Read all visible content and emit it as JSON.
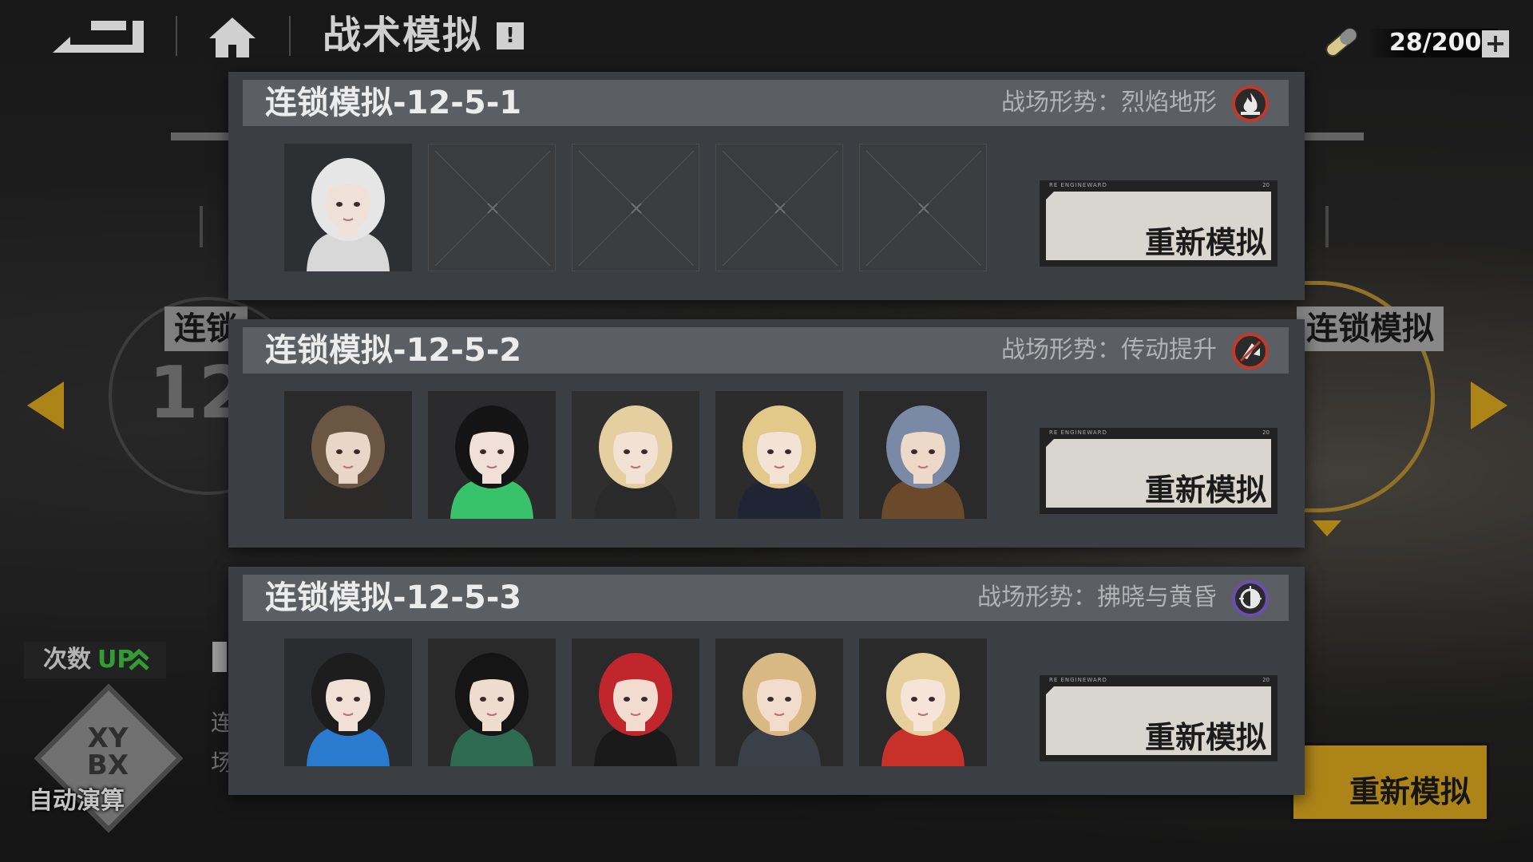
{
  "topbar": {
    "title": "战术模拟",
    "info_label": "!",
    "stamina": "28/200",
    "plus_label": "+"
  },
  "background": {
    "stage_left_label": "连锁",
    "stage_left_num": "12-",
    "stage_right_label": "连锁模拟",
    "count_up_label": "次数",
    "count_up_badge": "UP",
    "desc_line1": "连",
    "desc_line2": "场",
    "auto_logo": "XY\nBX",
    "auto_label": "自动演算",
    "yellow_button_label": "重新模拟"
  },
  "records": [
    {
      "title": "连锁模拟-12-5-1",
      "condition": "战场形势：烈焰地形",
      "condition_icon": "flame-icon",
      "accent": "#c0392b",
      "button_label": "重新模拟",
      "button_tag": "RE  ENGINEWARD",
      "button_num": "20",
      "team": [
        {
          "name": "white-hair-girl",
          "filled": true,
          "hair": "#e6e6e6",
          "skin": "#efe0d8",
          "bg": "#2d2f33",
          "outfit": "#d8d8d8"
        },
        {
          "filled": false
        },
        {
          "filled": false
        },
        {
          "filled": false
        },
        {
          "filled": false
        }
      ]
    },
    {
      "title": "连锁模拟-12-5-2",
      "condition": "战场形势：传动提升",
      "condition_icon": "gear-up-icon",
      "accent": "#c0392b",
      "button_label": "重新模拟",
      "button_tag": "RE  ENGINEWARD",
      "button_num": "20",
      "team": [
        {
          "name": "brown-hair-lady",
          "filled": true,
          "hair": "#6b5644",
          "skin": "#ead6c6",
          "bg": "#2a2a2a",
          "outfit": "#2b2a28"
        },
        {
          "name": "black-hair-catgirl",
          "filled": true,
          "hair": "#141414",
          "skin": "#f0e0d8",
          "bg": "#2b2b2e",
          "outfit": "#38c26a"
        },
        {
          "name": "blonde-wavy-girl",
          "filled": true,
          "hair": "#e3cfa0",
          "skin": "#f2e2d4",
          "bg": "#2f2f30",
          "outfit": "#2a2a2a"
        },
        {
          "name": "officer-cap-girl",
          "filled": true,
          "hair": "#e2c98a",
          "skin": "#f3e2d6",
          "bg": "#2c2c2c",
          "outfit": "#1f2535"
        },
        {
          "name": "cowboy-hat-girl",
          "filled": true,
          "hair": "#7a8aa6",
          "skin": "#eed8c8",
          "bg": "#2a2a2a",
          "outfit": "#6a4a2a"
        }
      ]
    },
    {
      "title": "连锁模拟-12-5-3",
      "condition": "战场形势：拂晓与黄昏",
      "condition_icon": "dawn-dusk-icon",
      "accent": "#6a4fb0",
      "button_label": "重新模拟",
      "button_tag": "RE  ENGINEWARD",
      "button_num": "20",
      "team": [
        {
          "name": "blue-streak-girl",
          "filled": true,
          "hair": "#1d1d1d",
          "skin": "#f0e0d6",
          "bg": "#2a2c30",
          "outfit": "#2a7bd0"
        },
        {
          "name": "black-bob-girl",
          "filled": true,
          "hair": "#151515",
          "skin": "#eedccf",
          "bg": "#2a2a2a",
          "outfit": "#2f6b52"
        },
        {
          "name": "red-hair-gunner",
          "filled": true,
          "hair": "#c0262b",
          "skin": "#f1dccf",
          "bg": "#2a2a2a",
          "outfit": "#1a1a1a"
        },
        {
          "name": "blonde-goggles-girl",
          "filled": true,
          "hair": "#d9b983",
          "skin": "#f2dccb",
          "bg": "#2a2a2a",
          "outfit": "#3a4048"
        },
        {
          "name": "blonde-fox-girl",
          "filled": true,
          "hair": "#e7cf9b",
          "skin": "#f6e4d8",
          "bg": "#2a2a2a",
          "outfit": "#c8312a"
        }
      ]
    }
  ]
}
